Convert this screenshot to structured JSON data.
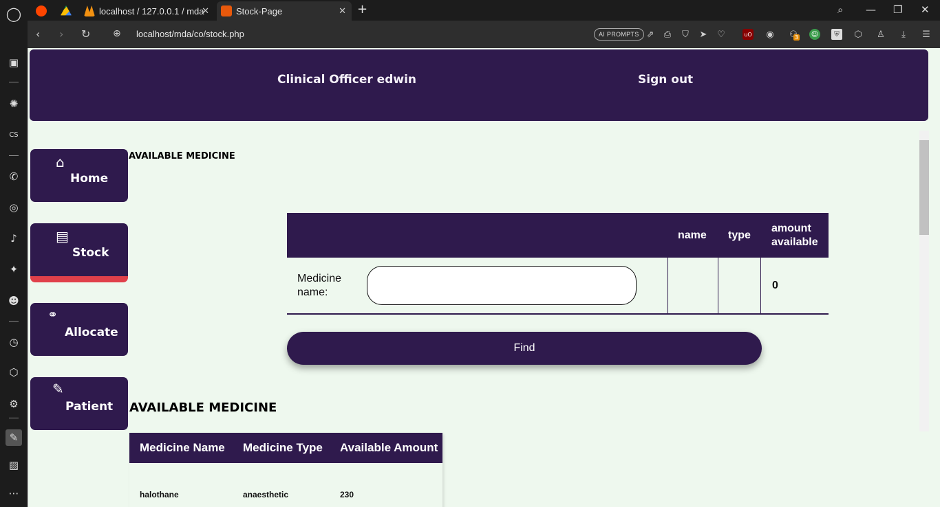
{
  "browser": {
    "tabs": [
      {
        "label": ""
      },
      {
        "label": ""
      },
      {
        "label": "localhost / 127.0.0.1 / mda"
      },
      {
        "label": "Stock-Page"
      }
    ],
    "url_host": "localhost",
    "url_path": "/mda/co/stock.php",
    "ai_prompts_label": "AI PROMPTS",
    "download_badge": "3"
  },
  "header": {
    "officer": "Clinical Officer edwin",
    "signout": "Sign out"
  },
  "nav": {
    "home": "Home",
    "stock": "Stock",
    "allocate": "Allocate",
    "patient": "Patient"
  },
  "section_small_title": "AVAILABLE MEDICINE",
  "search_table": {
    "col_name": "name",
    "col_type": "type",
    "col_amount_line1": "amount",
    "col_amount_line2": "available",
    "label_line1": "Medicine",
    "label_line2": "name:",
    "input_value": "",
    "input_placeholder": "",
    "amount_value": "0"
  },
  "find_button": "Find",
  "section_big_title": "AVAILABLE MEDICINE",
  "medicine_table": {
    "headers": [
      "Medicine Name",
      "Medicine Type",
      "Available Amount"
    ],
    "rows": [
      [
        "halothane",
        "anaesthetic",
        "230"
      ]
    ]
  },
  "colors": {
    "brand_purple": "#2f1a4d",
    "page_bg": "#eef8ee",
    "active_accent": "#e0404a"
  }
}
